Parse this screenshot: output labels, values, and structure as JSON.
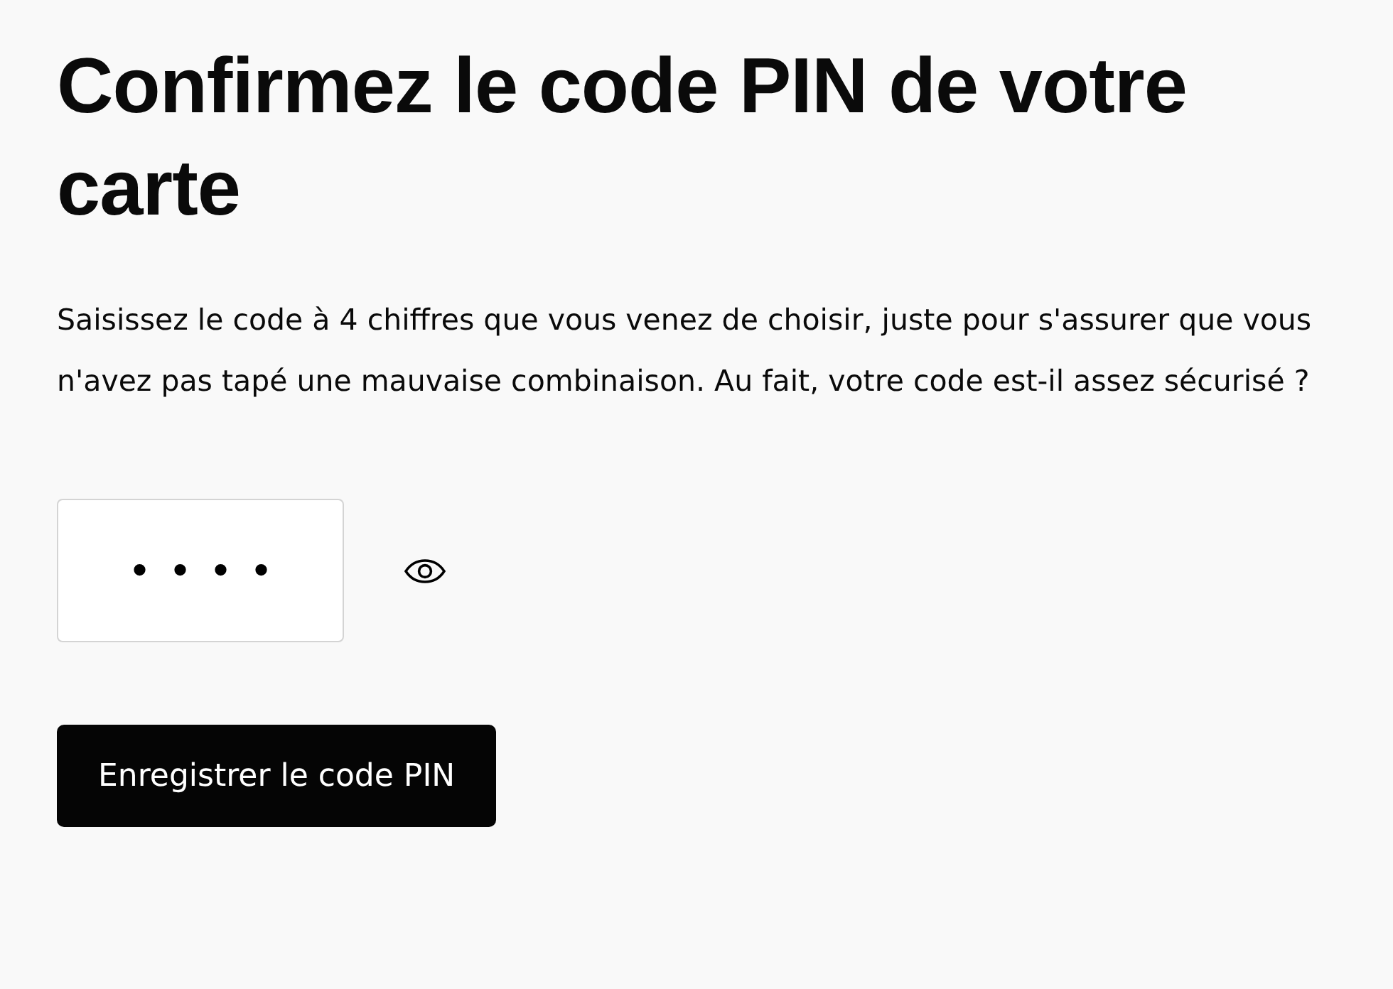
{
  "title": "Confirmez le code PIN de votre carte",
  "description": "Saisissez le code à 4 chiffres que vous venez de choisir, juste pour s'assurer que vous n'avez pas tapé une mauvaise combinaison. Au fait, votre code est-il assez sécurisé ?",
  "pin_field": {
    "value": "••••",
    "revealed": false
  },
  "save_button": {
    "label": "Enregistrer le code PIN"
  }
}
